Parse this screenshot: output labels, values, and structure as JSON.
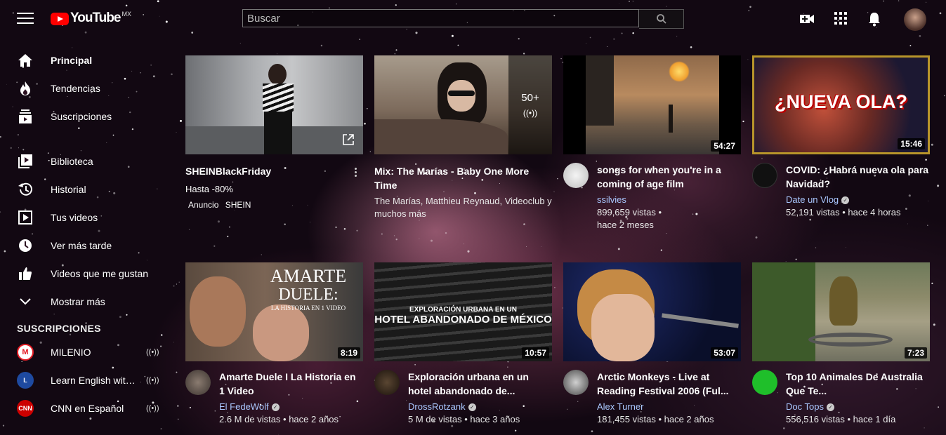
{
  "header": {
    "logo_text": "YouTube",
    "country_code": "MX",
    "search_placeholder": "Buscar"
  },
  "sidebar": {
    "items": [
      {
        "label": "Principal",
        "icon": "home-icon"
      },
      {
        "label": "Tendencias",
        "icon": "flame-icon"
      },
      {
        "label": "Suscripciones",
        "icon": "subscriptions-icon"
      },
      {
        "label": "Biblioteca",
        "icon": "library-icon"
      },
      {
        "label": "Historial",
        "icon": "history-icon"
      },
      {
        "label": "Tus videos",
        "icon": "your-videos-icon"
      },
      {
        "label": "Ver más tarde",
        "icon": "clock-icon"
      },
      {
        "label": "Videos que me gustan",
        "icon": "thumbs-up-icon"
      },
      {
        "label": "Mostrar más",
        "icon": "chevron-down-icon"
      }
    ],
    "subscriptions_header": "SUSCRIPCIONES",
    "subscriptions": [
      {
        "label": "MILENIO",
        "badge": "M",
        "color": "#e31b23"
      },
      {
        "label": "Learn English with ...",
        "badge": "L",
        "color": "#1e4aa0"
      },
      {
        "label": "CNN en Español",
        "badge": "CNN",
        "color": "#cc0000"
      }
    ]
  },
  "videos": [
    {
      "title": "SHEINBlackFriday",
      "line1": "Hasta -80%",
      "ad_label": "Anuncio",
      "advertiser": "SHEIN"
    },
    {
      "title": "Mix: The Marías - Baby One More Time",
      "channel": "The Marías, Matthieu Reynaud, Videoclub y muchos más",
      "count": "50+"
    },
    {
      "title": "songs for when you're in a coming of age film",
      "channel": "ssilvies",
      "views": "899,659 vistas •",
      "age": "hace 2 meses",
      "duration": "54:27"
    },
    {
      "title": "COVID: ¿Habrá nueva ola para Navidad?",
      "channel": "Date un Vlog",
      "stats": "52,191 vistas • hace 4 horas",
      "duration": "15:46",
      "thumb_text": "¿NUEVA OLA?"
    },
    {
      "title": "Amarte Duele I La Historia en 1 Video",
      "channel": "El FedeWolf",
      "stats": "2.6 M de vistas • hace 2 años",
      "duration": "8:19",
      "thumb_text_1": "AMARTE",
      "thumb_text_2": "DUELE:",
      "thumb_text_3": "LA HISTORIA EN 1 VIDEO"
    },
    {
      "title": "Exploración urbana en un hotel abandonado de...",
      "channel": "DrossRotzank",
      "stats": "5 M de vistas • hace 3 años",
      "duration": "10:57",
      "thumb_text_1": "EXPLORACIÓN URBANA EN UN",
      "thumb_text_2": "HOTEL ABANDONADO DE MÉXICO"
    },
    {
      "title": "Arctic Monkeys - Live at Reading Festival 2006 (Ful...",
      "channel": "Alex Turner",
      "stats": "181,455 vistas • hace 2 años",
      "duration": "53:07"
    },
    {
      "title": "Top 10 Animales De Australia Que Te...",
      "channel": "Doc Tops",
      "stats": "556,516 vistas • hace 1 día",
      "duration": "7:23"
    }
  ]
}
